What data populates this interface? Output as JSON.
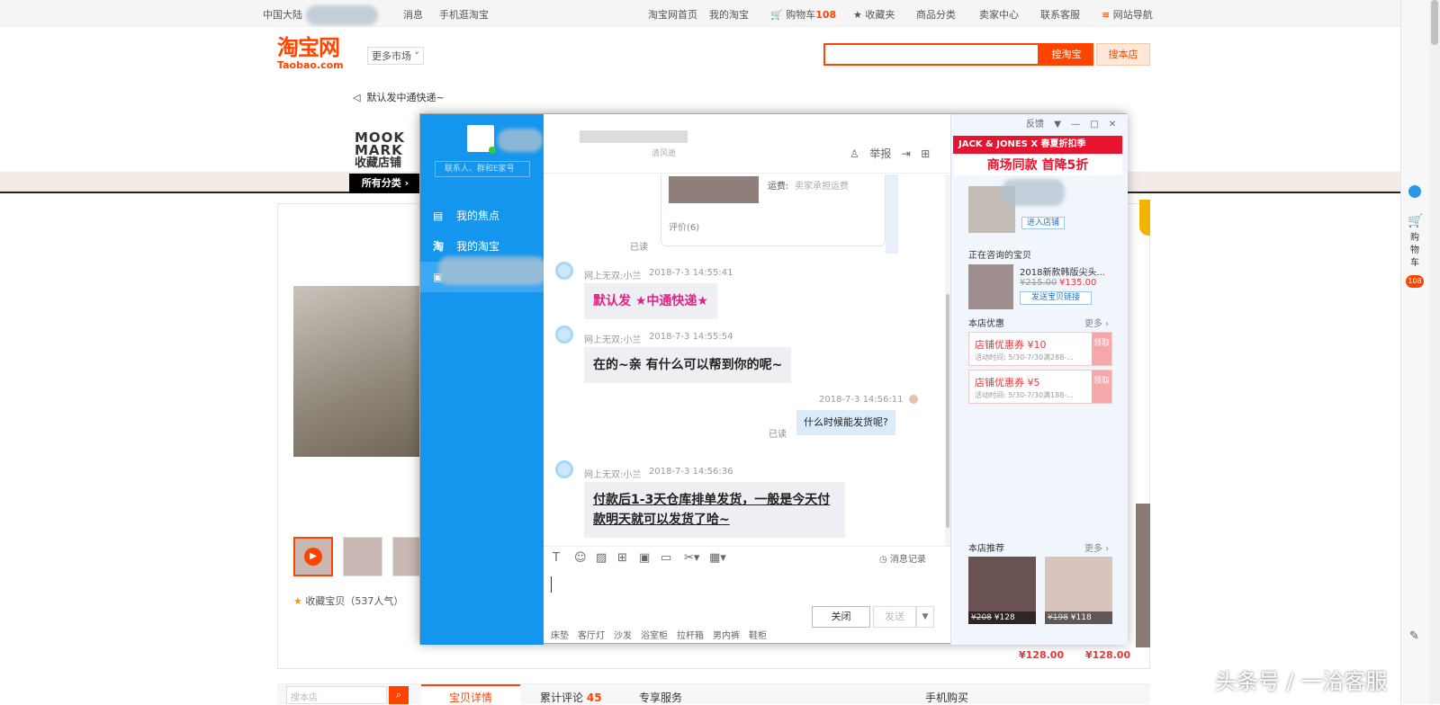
{
  "topbar": {
    "region": "中国大陆",
    "messages": "消息",
    "mobile": "手机逛淘宝",
    "home": "淘宝网首页",
    "my_taobao": "我的淘宝",
    "cart_label": "购物车",
    "cart_count": "108",
    "favorites": "收藏夹",
    "categories": "商品分类",
    "seller": "卖家中心",
    "service": "联系客服",
    "sitemap": "网站导航"
  },
  "header": {
    "logo_cn": "淘宝网",
    "logo_en": "Taobao.com",
    "more_market": "更多市场",
    "search_btn": "搜淘宝",
    "shop_search_btn": "搜本店",
    "notice": "默认发中通快递~"
  },
  "shop": {
    "brand_line1": "MOOK",
    "brand_line2": "MARK",
    "fav_shop": "收藏店铺",
    "all_categories": "所有分类",
    "collect_item": "收藏宝贝（537人气）",
    "price1": "¥128.00",
    "price2": "¥128.00"
  },
  "bottom_tabs": {
    "search_placeholder": "搜本店",
    "detail": "宝贝详情",
    "reviews": "累计评论",
    "reviews_count": "45",
    "service": "专享服务",
    "mobile_buy": "手机购买"
  },
  "chat": {
    "contact_search_placeholder": "联系人、群和E家号",
    "nav": [
      {
        "label": "我的焦点"
      },
      {
        "label": "我的淘宝"
      }
    ],
    "header_report": "举报",
    "header_status": "清风逝",
    "card": {
      "shipping_label": "运费:",
      "shipping_value": "卖家承担运费",
      "reviews": "评价(6)",
      "read": "已读"
    },
    "messages": [
      {
        "sender": "网上无双:小兰",
        "time": "2018-7-3 14:55:41",
        "text": "默认发 ★中通快递★"
      },
      {
        "sender": "网上无双:小兰",
        "time": "2018-7-3 14:55:54",
        "text": "在的~亲   有什么可以帮到你的呢~"
      },
      {
        "sender": "",
        "time": "2018-7-3 14:56:11",
        "text": "什么时候能发货呢?",
        "read": "已读"
      },
      {
        "sender": "网上无双:小兰",
        "time": "2018-7-3 14:56:36",
        "text": "付款后1-3天仓库排单发货，一般是今天付款明天就可以发货了哈~"
      }
    ],
    "history": "消息记录",
    "quick_words": [
      "床垫",
      "客厅灯",
      "沙发",
      "浴室柜",
      "拉杆箱",
      "男内裤",
      "鞋柜"
    ],
    "close_btn": "关闭",
    "send_btn": "发送"
  },
  "panel": {
    "feedback": "反馈",
    "banner_brand": "JACK & JONES",
    "banner_x": "X",
    "banner_event": "春夏折扣季",
    "banner_slogan": "商场同款 首降5折",
    "enter_shop": "进入店铺",
    "consulting": "正在咨询的宝贝",
    "product_name": "2018新款韩版尖头...",
    "product_old_price": "¥215.00",
    "product_price": "¥135.00",
    "send_link": "发送宝贝链接",
    "offers_title": "本店优惠",
    "more": "更多",
    "coupons": [
      {
        "title": "店铺优惠券   ¥10",
        "period": "活动时间: 5/30-7/30满288-...",
        "get": "领取"
      },
      {
        "title": "店铺优惠券   ¥5",
        "period": "活动时间: 5/30-7/30满188-...",
        "get": "领取"
      }
    ],
    "rec_title": "本店推荐",
    "recs": [
      {
        "old": "¥208",
        "price": "¥128"
      },
      {
        "old": "¥198",
        "price": "¥118"
      }
    ]
  },
  "sidebar": {
    "cart": "购物车",
    "count": "108"
  },
  "watermark": "头条号 / 一洽客服"
}
